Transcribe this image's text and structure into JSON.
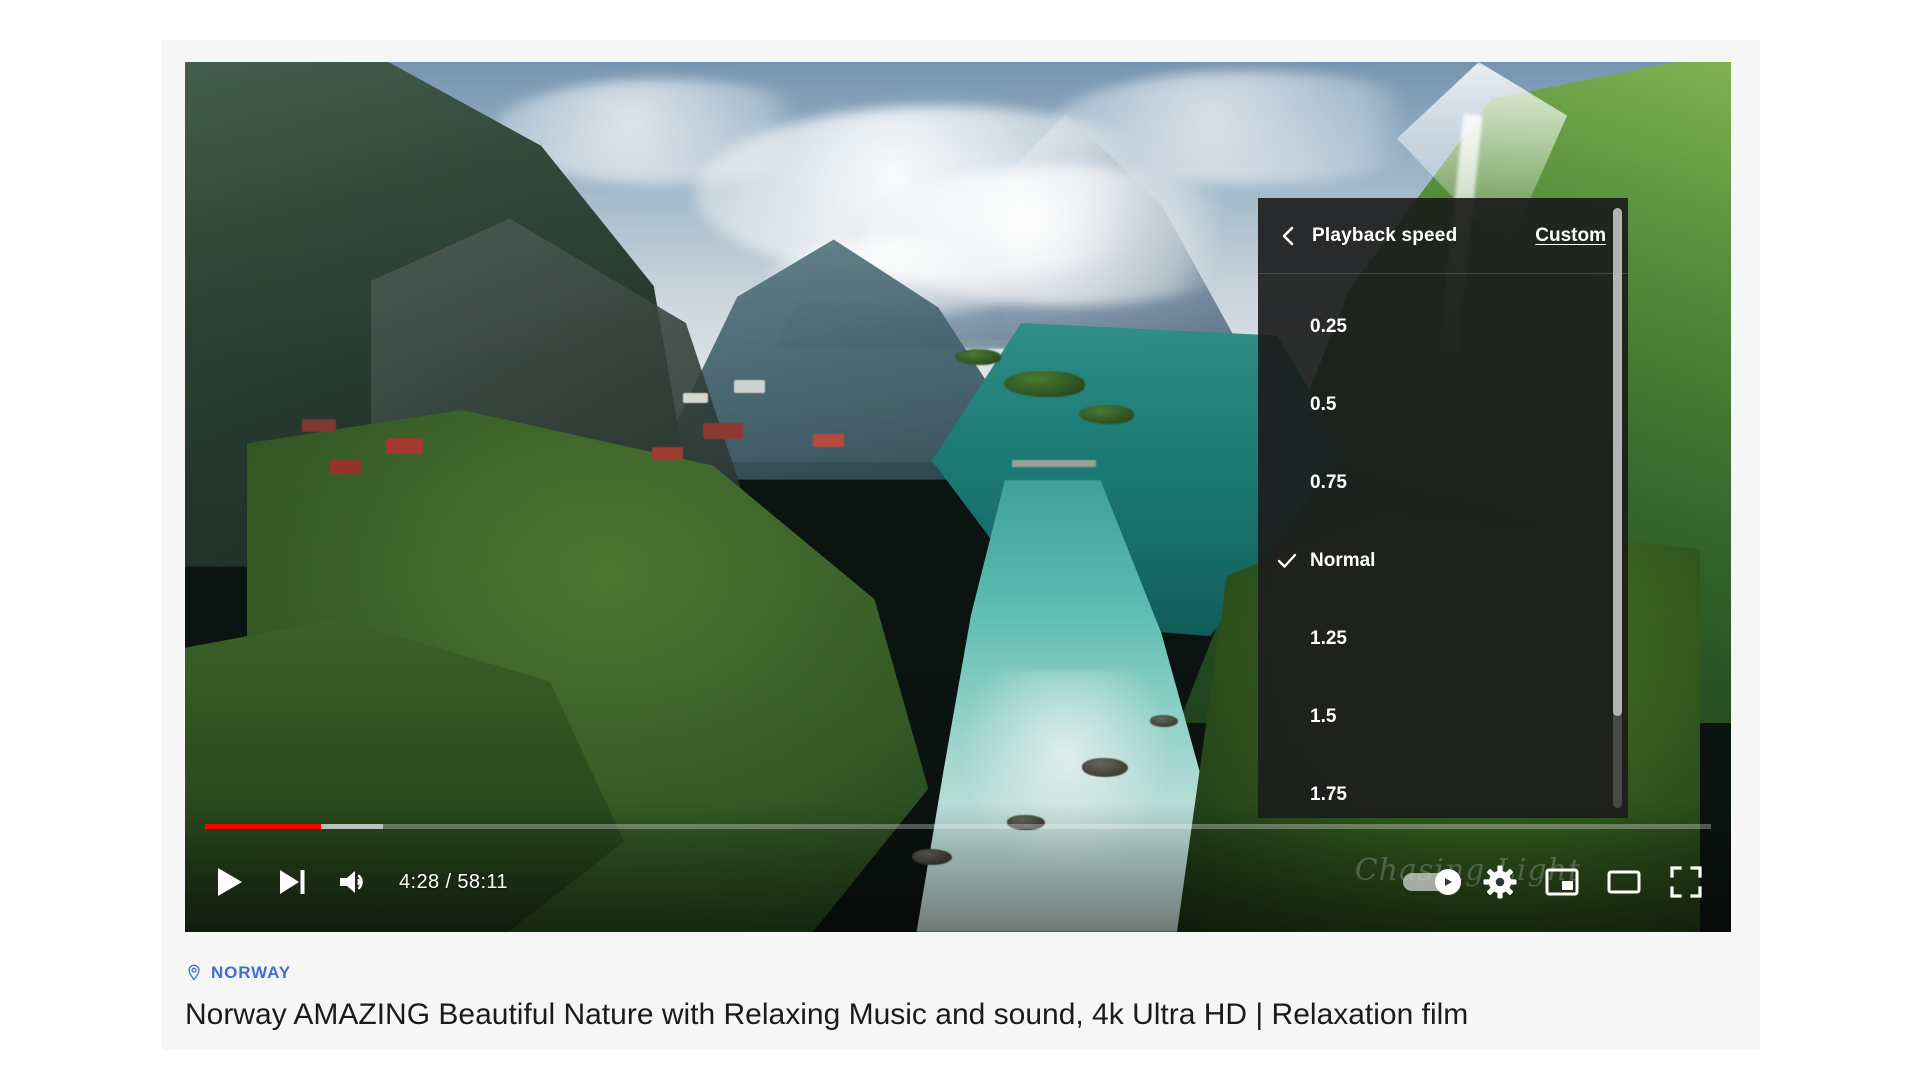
{
  "player": {
    "time_current": "4:28",
    "time_total": "58:11",
    "time_display": "4:28 / 58:11",
    "progress_played_percent": 7.7,
    "progress_buffered_percent": 11.8,
    "progress_color": "#ff0000",
    "watermark_text": "Chasing Light",
    "controls": {
      "play_label": "Play",
      "next_label": "Next",
      "volume_label": "Mute",
      "autoplay_label": "Autoplay is on",
      "settings_label": "Settings",
      "miniplayer_label": "Miniplayer",
      "theater_label": "Theater mode",
      "fullscreen_label": "Full screen"
    }
  },
  "settings_menu": {
    "back_label": "Back",
    "title": "Playback speed",
    "custom_label": "Custom",
    "selected": "Normal",
    "options": [
      {
        "label": "0.25",
        "checked": false
      },
      {
        "label": "0.5",
        "checked": false
      },
      {
        "label": "0.75",
        "checked": false
      },
      {
        "label": "Normal",
        "checked": true
      },
      {
        "label": "1.25",
        "checked": false
      },
      {
        "label": "1.5",
        "checked": false
      },
      {
        "label": "1.75",
        "checked": false
      }
    ]
  },
  "meta": {
    "place": "NORWAY",
    "place_color": "#3d6fd1",
    "title": "Norway AMAZING Beautiful Nature with Relaxing Music and sound, 4k Ultra HD | Relaxation film"
  }
}
